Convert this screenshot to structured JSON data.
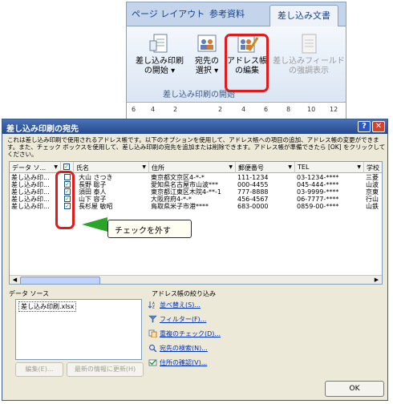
{
  "ribbon": {
    "tabs": [
      "ページ レイアウト",
      "参考資料",
      "差し込み文書"
    ],
    "active_tab": "差し込み文書",
    "buttons": [
      {
        "line1": "差し込み印刷",
        "line2": "の開始 ▾",
        "icon": "document-merge-icon"
      },
      {
        "line1": "宛先の",
        "line2": "選択 ▾",
        "icon": "recipients-icon"
      },
      {
        "line1": "アドレス帳",
        "line2": "の編集",
        "icon": "edit-address-book-icon"
      },
      {
        "line1": "差し込みフィールド",
        "line2": "の強調表示",
        "icon": "highlight-fields-icon"
      }
    ],
    "group_label": "差し込み印刷の開始",
    "ruler_ticks": [
      "6",
      "4",
      "2",
      "",
      "2",
      "4",
      "6",
      "8",
      "10",
      "12"
    ]
  },
  "dialog": {
    "title": "差し込み印刷の宛先",
    "description": "これは差し込み印刷で使用されるアドレス帳です。以下のオプションを使用して、アドレス帳への項目の追加、アドレス帳の変更ができます。また、チェック ボックスを使用して、差し込み印刷の宛先を追加または削除できます。アドレス帳が準備できたら [OK] をクリックしてください。",
    "columns": [
      "データ ソ...",
      "",
      "氏名",
      "住所",
      "郵便番号",
      "TEL",
      "学校"
    ],
    "rows": [
      {
        "source": "差し込み印...",
        "checked": false,
        "name": "大山 さつき",
        "address": "東京都文京区4-*-*",
        "zip": "111-1234",
        "tel": "03-1234-****",
        "school": "三菱"
      },
      {
        "source": "差し込み印...",
        "checked": true,
        "name": "長野 聡子",
        "address": "愛知県名古屋市山波***",
        "zip": "000-4455",
        "tel": "045-444-****",
        "school": "山波"
      },
      {
        "source": "差し込み印...",
        "checked": true,
        "name": "須田 泰人",
        "address": "東京都江東区木院4-**-1",
        "zip": "777-8888",
        "tel": "03-9999-****",
        "school": "京東"
      },
      {
        "source": "差し込み印...",
        "checked": true,
        "name": "山下 容子",
        "address": "大阪府府4-*-*",
        "zip": "456-4567",
        "tel": "06-7777-****",
        "school": "行山"
      },
      {
        "source": "差し込み印...",
        "checked": true,
        "name": "長杉屋 敏昭",
        "address": "鳥取県米子市港****",
        "zip": "683-0000",
        "tel": "0859-00-****",
        "school": "山鉄"
      }
    ],
    "callout": "チェックを外す",
    "data_source_label": "データ ソース",
    "data_source_item": "差し込み印刷.xlsx",
    "edit_button": "編集(E)...",
    "refresh_button": "最新の情報に更新(H)",
    "refine_label": "アドレス帳の絞り込み",
    "links": [
      "並べ替え(S)...",
      "フィルター(F)...",
      "重複のチェック(D)...",
      "宛先の検索(N)...",
      "住所の確認(V)..."
    ],
    "ok_button": "OK",
    "help_glyph": "?",
    "close_glyph": "✕",
    "colors": {
      "highlight": "#e21a1a",
      "arrow": "#2aa52a",
      "titlebar": "#24498f",
      "link": "#0033bb"
    }
  }
}
